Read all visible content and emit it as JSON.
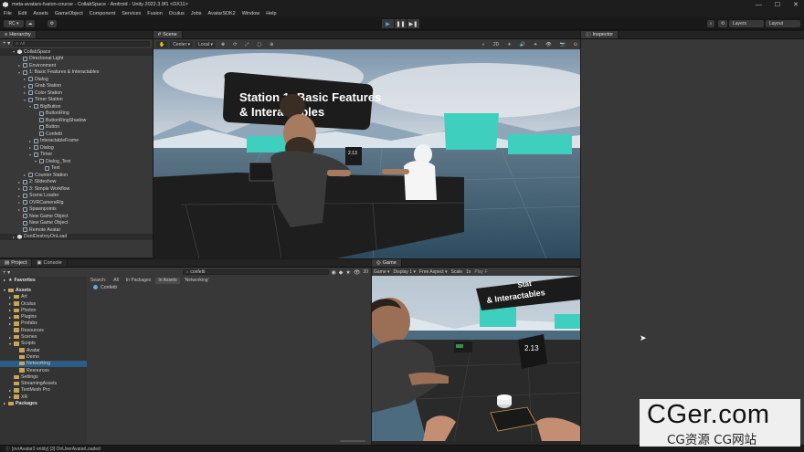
{
  "window": {
    "title": "meta-avatars-fusion-course - CollabSpace - Android - Unity 2022.3.9f1 <DX11>",
    "minimize": "—",
    "maximize": "☐",
    "close": "✕"
  },
  "menu": [
    "File",
    "Edit",
    "Assets",
    "GameObject",
    "Component",
    "Services",
    "Fusion",
    "Oculus",
    "Jobs",
    "AvatarSDK2",
    "Window",
    "Help"
  ],
  "toolbar": {
    "account": "RC ▾",
    "layers": "Layers",
    "layout": "Layout"
  },
  "hierarchy": {
    "tab": "Hierarchy",
    "search_placeholder": "All",
    "scene_name": "CollabSpace",
    "items": [
      {
        "label": "Directional Light",
        "depth": 1,
        "arrow": ""
      },
      {
        "label": "Environment",
        "depth": 1,
        "arrow": "▸"
      },
      {
        "label": "1: Basic Features & Interactables",
        "depth": 1,
        "arrow": "▾"
      },
      {
        "label": "Dialog",
        "depth": 2,
        "arrow": "▸"
      },
      {
        "label": "Grab Station",
        "depth": 2,
        "arrow": "▸"
      },
      {
        "label": "Color Station",
        "depth": 2,
        "arrow": "▸"
      },
      {
        "label": "Timer Station",
        "depth": 2,
        "arrow": "▾"
      },
      {
        "label": "BigButton",
        "depth": 3,
        "arrow": "▾"
      },
      {
        "label": "ButtonRing",
        "depth": 4,
        "arrow": ""
      },
      {
        "label": "ButtonRingShadow",
        "depth": 4,
        "arrow": ""
      },
      {
        "label": "Button",
        "depth": 4,
        "arrow": ""
      },
      {
        "label": "Confetti",
        "depth": 4,
        "arrow": ""
      },
      {
        "label": "InteractableFrame",
        "depth": 3,
        "arrow": "▸"
      },
      {
        "label": "Dialog",
        "depth": 3,
        "arrow": "▸"
      },
      {
        "label": "Timer",
        "depth": 3,
        "arrow": "▾"
      },
      {
        "label": "Dialog_Text",
        "depth": 4,
        "arrow": "▾"
      },
      {
        "label": "Text",
        "depth": 5,
        "arrow": ""
      },
      {
        "label": "Counter Station",
        "depth": 2,
        "arrow": "▸"
      },
      {
        "label": "2: Slideshow",
        "depth": 1,
        "arrow": "▸"
      },
      {
        "label": "3: Simple Workflow",
        "depth": 1,
        "arrow": "▸"
      },
      {
        "label": "Scene Loader",
        "depth": 1,
        "arrow": "▸"
      },
      {
        "label": "OVRCameraRig",
        "depth": 1,
        "arrow": "▸"
      },
      {
        "label": "Spawnpoints",
        "depth": 1,
        "arrow": "▸"
      },
      {
        "label": "New Game Object",
        "depth": 1,
        "arrow": ""
      },
      {
        "label": "New Game Object",
        "depth": 1,
        "arrow": ""
      },
      {
        "label": "Remote Avatar",
        "depth": 1,
        "arrow": ""
      }
    ],
    "dont_destroy": "DontDestroyOnLoad"
  },
  "scene": {
    "tab": "Scene",
    "center": "Center ▾",
    "local": "Local ▾",
    "mode_2d": "2D",
    "sign_text": "Station 1: Basic Features & Interactables",
    "sign_line1": "Station 1: Basic Features",
    "sign_line2": "& Interactables",
    "timer_value": "2.13"
  },
  "inspector": {
    "tab": "Inspector"
  },
  "project": {
    "tab_project": "Project",
    "tab_console": "Console",
    "search_value": "confetti",
    "count": "20",
    "favorites": "Favorites",
    "assets_root": "Assets",
    "folders": [
      {
        "label": "Art",
        "depth": 1,
        "arrow": "▸"
      },
      {
        "label": "Oculus",
        "depth": 1,
        "arrow": "▸"
      },
      {
        "label": "Photon",
        "depth": 1,
        "arrow": "▸"
      },
      {
        "label": "Plugins",
        "depth": 1,
        "arrow": "▸"
      },
      {
        "label": "Prefabs",
        "depth": 1,
        "arrow": "▸"
      },
      {
        "label": "Resources",
        "depth": 1,
        "arrow": ""
      },
      {
        "label": "Scenes",
        "depth": 1,
        "arrow": "▸"
      },
      {
        "label": "Scripts",
        "depth": 1,
        "arrow": "▾"
      },
      {
        "label": "Avatar",
        "depth": 2,
        "arrow": ""
      },
      {
        "label": "Demo",
        "depth": 2,
        "arrow": ""
      },
      {
        "label": "Networking",
        "depth": 2,
        "arrow": "",
        "selected": true
      },
      {
        "label": "Resources",
        "depth": 2,
        "arrow": ""
      },
      {
        "label": "Settings",
        "depth": 1,
        "arrow": ""
      },
      {
        "label": "StreamingAssets",
        "depth": 1,
        "arrow": ""
      },
      {
        "label": "TextMesh Pro",
        "depth": 1,
        "arrow": "▸"
      },
      {
        "label": "XR",
        "depth": 1,
        "arrow": "▸"
      }
    ],
    "packages": "Packages",
    "filter_label": "Search:",
    "filters": [
      "All",
      "In Packages",
      "In Assets",
      "'Networking'"
    ],
    "result": "Confetti"
  },
  "game": {
    "tab": "Game",
    "display": "Game ▾",
    "display_num": "Display 1 ▾",
    "aspect": "Free Aspect ▾",
    "scale_label": "Scale",
    "scale_value": "1x",
    "play_label": "Play F",
    "sign_line1": "Stat",
    "sign_line2": "& Interactables",
    "timer_value": "2.13"
  },
  "status": {
    "message": "[ovrAvatar2 entity] [3] OnUserAvatarLoaded"
  },
  "watermark": {
    "big": "CGer.com",
    "small": "CG资源 CG网站"
  },
  "colors": {
    "accent": "#4aa8ff",
    "selection": "#2c5d87",
    "teal_block": "#3ecfbf",
    "panel": "#383838"
  }
}
